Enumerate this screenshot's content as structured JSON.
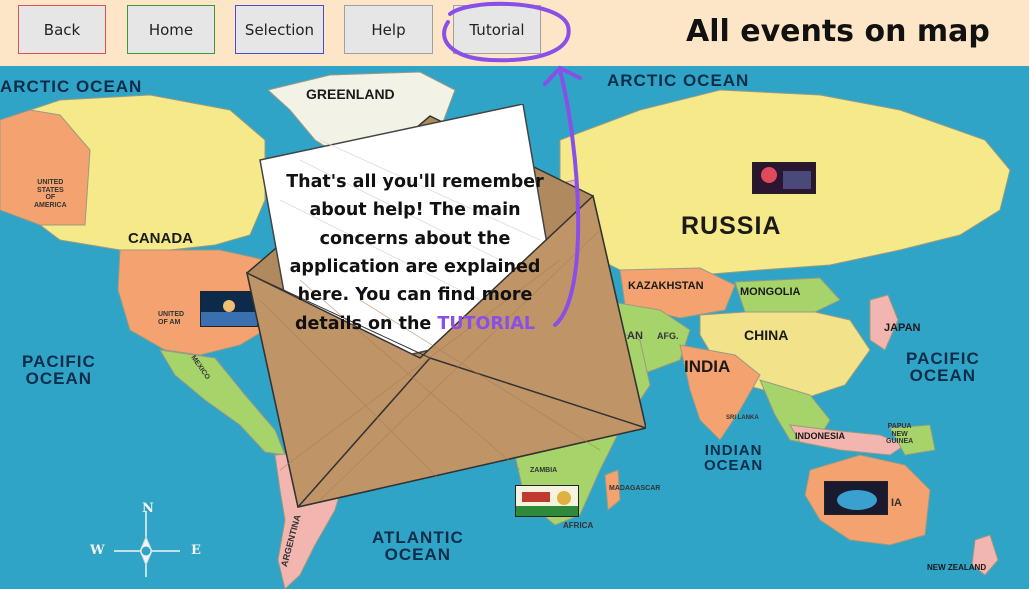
{
  "toolbar": {
    "back_label": "Back",
    "home_label": "Home",
    "selection_label": "Selection",
    "help_label": "Help",
    "tutorial_label": "Tutorial"
  },
  "page": {
    "title": "All events on map"
  },
  "help_message": {
    "text": "That's all you'll remember about help! The main concerns about the application are explained here. You can find more details on the",
    "link_text": "TUTORIAL",
    "link_color": "#8a4fe6"
  },
  "map": {
    "labels": {
      "arctic_left": "ARCTIC OCEAN",
      "arctic_right": "ARCTIC OCEAN",
      "greenland": "GREENLAND",
      "canada": "CANADA",
      "russia": "RUSSIA",
      "kazakhstan": "KAZAKHSTAN",
      "mongolia": "MONGOLIA",
      "china": "CHINA",
      "india": "INDIA",
      "japan": "JAPAN",
      "pacific_left": "PACIFIC\nOCEAN",
      "pacific_right": "PACIFIC\nOCEAN",
      "indian_ocean": "INDIAN\nOCEAN",
      "atlantic": "ATLANTIC\nOCEAN",
      "indonesia": "INDONESIA",
      "papua": "PAPUA\nNEW\nGUINEA",
      "new_zealand": "NEW ZEALAND",
      "usa_top": "UNITED\nSTATES\nOF\nAMERICA",
      "usa_mid": "UNITED\nOF AM",
      "mexico": "MEXICO",
      "argentina": "ARGENTINA",
      "zambia": "ZAMBIA",
      "madagascar": "MADAGASCAR",
      "africa_sa": "AFRICA",
      "sri_lanka": "SRI LANKA",
      "afghanistan": "AFG.",
      "iran": "AN",
      "australia": "IA"
    },
    "compass": {
      "n": "N",
      "e": "E",
      "w": "W"
    },
    "colors": {
      "ocean": "#2fa4c6",
      "land_yellow": "#f5e98a",
      "land_orange": "#f4a270",
      "land_green": "#a6d46a",
      "land_pink": "#f2b5b0",
      "ice": "#e8f4f4"
    }
  },
  "annotation": {
    "color": "#8a4fe6"
  }
}
